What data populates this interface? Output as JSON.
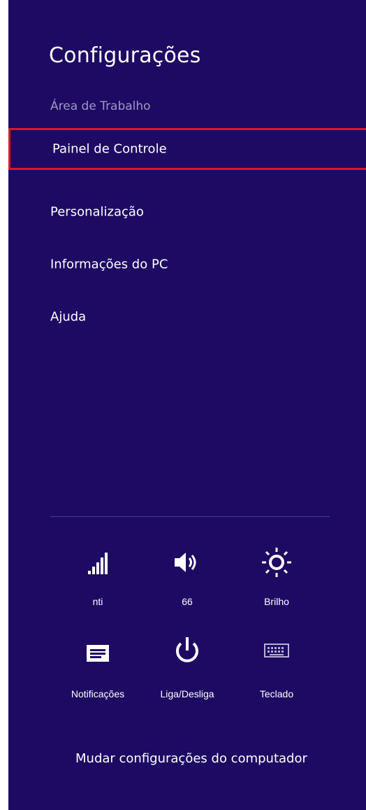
{
  "panel": {
    "title": "Configurações",
    "context": "Área de Trabalho"
  },
  "menu": [
    {
      "label": "Painel de Controle",
      "highlighted": true
    },
    {
      "label": "Personalização"
    },
    {
      "label": "Informações do PC"
    },
    {
      "label": "Ajuda"
    }
  ],
  "quick_settings": [
    {
      "icon": "network-signal-icon",
      "label": "nti"
    },
    {
      "icon": "volume-icon",
      "label": "66"
    },
    {
      "icon": "brightness-icon",
      "label": "Brilho"
    },
    {
      "icon": "notifications-icon",
      "label": "Notificações"
    },
    {
      "icon": "power-icon",
      "label": "Liga/Desliga"
    },
    {
      "icon": "keyboard-icon",
      "label": "Teclado"
    }
  ],
  "footer": {
    "label": "Mudar configurações do computador"
  },
  "colors": {
    "background": "#1e0a63",
    "highlight_border": "#e0161e",
    "muted_text": "#9f98c6"
  }
}
